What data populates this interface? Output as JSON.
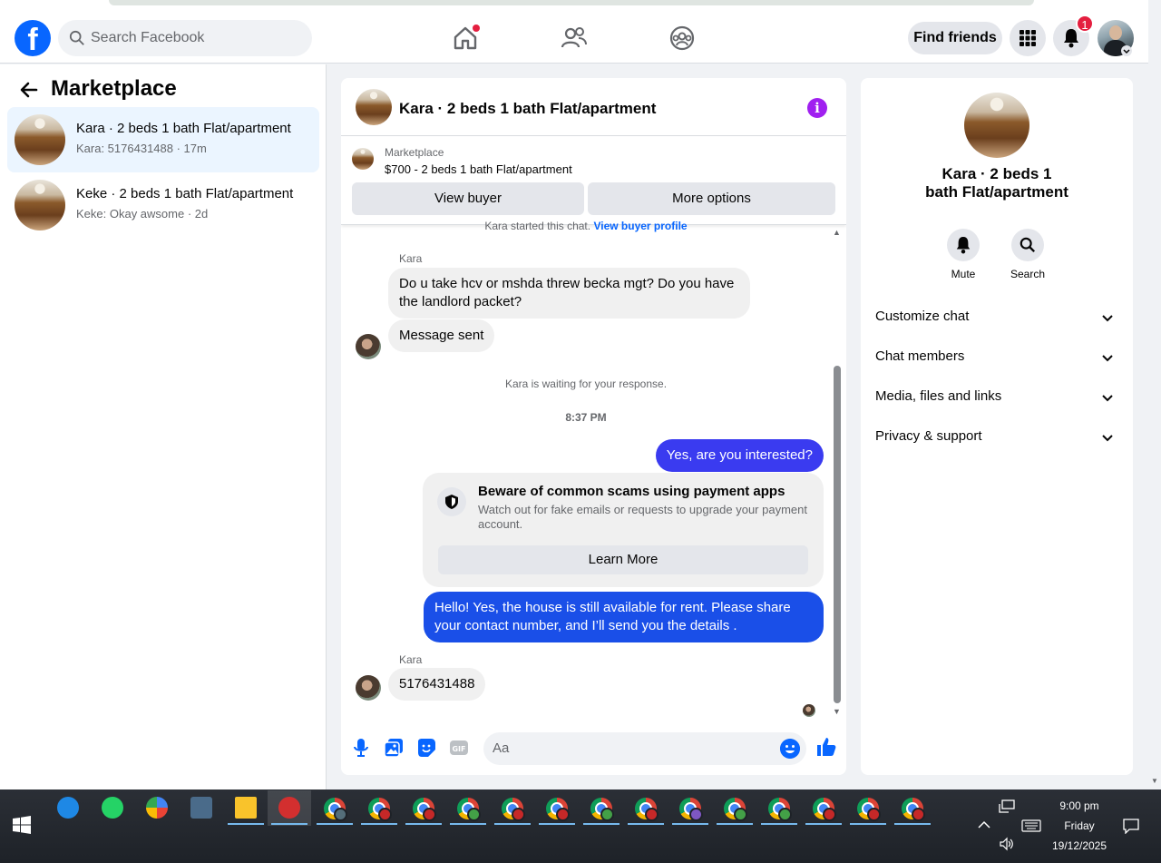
{
  "topbar": {
    "search_placeholder": "Search Facebook",
    "find_friends": "Find friends",
    "notif_count": "1"
  },
  "sidebar": {
    "title": "Marketplace",
    "conversations": [
      {
        "name": "Kara · 2 beds 1 bath Flat/apartment",
        "preview": "Kara: 5176431488 · 17m"
      },
      {
        "name": "Keke · 2 beds 1 bath Flat/apartment",
        "preview": "Keke: Okay awsome · 2d"
      }
    ]
  },
  "chat": {
    "title": "Kara · 2 beds 1 bath Flat/apartment",
    "marketplace_label": "Marketplace",
    "listing": "$700 - 2 beds 1 bath Flat/apartment",
    "view_buyer": "View buyer",
    "more_options": "More options",
    "started_text": "Kara started this chat.",
    "view_buyer_profile": "View buyer profile",
    "sender": "Kara",
    "msg1": "Do u take hcv or mshda threw becka mgt? Do you have the landlord packet?",
    "msg2": "Message sent",
    "waiting": "Kara is waiting for your response.",
    "time": "8:37 PM",
    "out1": "Yes, are you interested?",
    "scam_title": "Beware of common scams using payment apps",
    "scam_text": "Watch out for fake emails or requests to upgrade your payment account.",
    "learn_more": "Learn More",
    "out2": "Hello! Yes, the house is still available for rent. Please share your contact number, and I’ll send you the details .",
    "sender2": "Kara",
    "msg3": "5176431488",
    "input_placeholder": "Aa"
  },
  "details": {
    "title": "Kara · 2 beds 1 bath Flat/apartment",
    "mute": "Mute",
    "search": "Search",
    "sections": [
      "Customize chat",
      "Chat members",
      "Media, files and links",
      "Privacy & support"
    ]
  },
  "taskbar": {
    "time": "9:00 pm",
    "day": "Friday",
    "date": "19/12/2025"
  },
  "colors": {
    "brand": "#0866ff",
    "outgoing": "#3a3bf0",
    "highlight": "#ebf5ff"
  }
}
